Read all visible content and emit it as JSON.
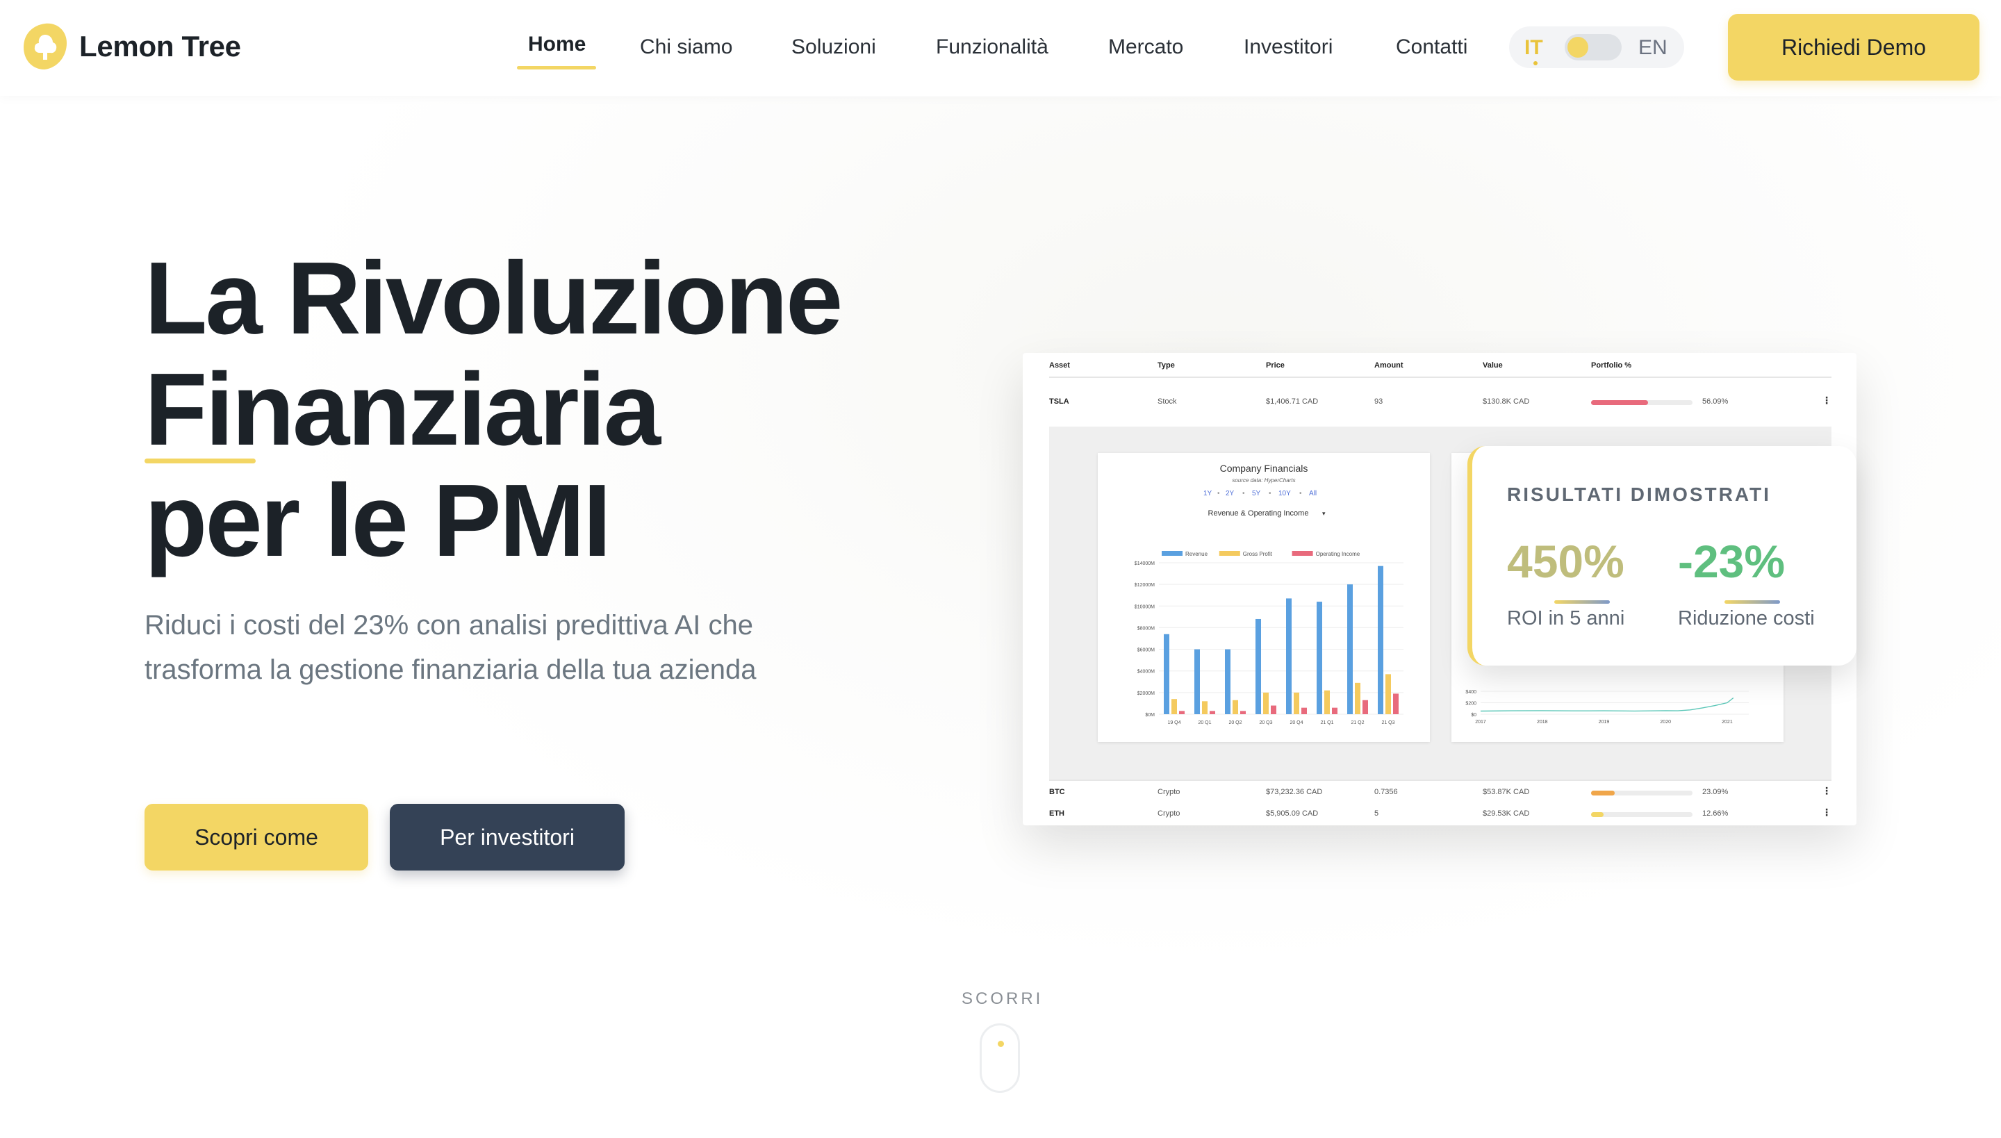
{
  "brand": {
    "name": "Lemon Tree",
    "color": "#f3d664",
    "icon": "lemon-tree-logo-icon"
  },
  "nav": {
    "items": [
      "Home",
      "Chi siamo",
      "Soluzioni",
      "Funzionalità",
      "Mercato",
      "Investitori",
      "Contatti"
    ],
    "active": "Home"
  },
  "lang": {
    "it": "IT",
    "en": "EN",
    "selected": "IT"
  },
  "header": {
    "demo_label": "Richiedi Demo"
  },
  "hero": {
    "title_line1": "La Rivoluzione",
    "title_line2": "Finanziaria",
    "title_line3": "per le PMI",
    "subtitle": "Riduci i costi del 23% con analisi predittiva AI che trasforma la gestione finanziaria della tua azienda",
    "cta_primary": "Scopri come",
    "cta_secondary": "Per investitori"
  },
  "dashboard": {
    "columns": [
      "Asset",
      "Type",
      "Price",
      "Amount",
      "Value",
      "Portfolio %"
    ],
    "rows": [
      {
        "asset": "TSLA",
        "type": "Stock",
        "price": "$1,406.71 CAD",
        "amount": "93",
        "value": "$130.8K CAD",
        "portfolio": "56.09%",
        "fill": 0.5609,
        "color": "#e86a7c"
      },
      {
        "asset": "BTC",
        "type": "Crypto",
        "price": "$73,232.36 CAD",
        "amount": "0.7356",
        "value": "$53.87K CAD",
        "portfolio": "23.09%",
        "fill": 0.2309,
        "color": "#f0a64a"
      },
      {
        "asset": "ETH",
        "type": "Crypto",
        "price": "$5,905.09 CAD",
        "amount": "5",
        "value": "$29.53K CAD",
        "portfolio": "12.66%",
        "fill": 0.1266,
        "color": "#f3d664"
      }
    ],
    "company_chart": {
      "title": "Company Financials",
      "source": "source data: HyperCharts",
      "ranges": [
        "1Y",
        "2Y",
        "5Y",
        "10Y",
        "All"
      ],
      "dropdown": "Revenue & Operating Income"
    },
    "price_chart": {
      "y_ticks": [
        "$400",
        "$200",
        "$0"
      ],
      "x_ticks": [
        "2017",
        "2018",
        "2019",
        "2020",
        "2021"
      ]
    }
  },
  "chart_data": [
    {
      "type": "bar",
      "title": "Company Financials",
      "categories": [
        "19 Q4",
        "20 Q1",
        "20 Q2",
        "20 Q3",
        "20 Q4",
        "21 Q1",
        "21 Q2",
        "21 Q3"
      ],
      "series": [
        {
          "name": "Revenue",
          "color": "#5aa0e0",
          "values": [
            7400,
            6000,
            6000,
            8800,
            10700,
            10400,
            12000,
            13700
          ]
        },
        {
          "name": "Gross Profit",
          "color": "#f4ca5e",
          "values": [
            1400,
            1200,
            1300,
            2000,
            2000,
            2200,
            2900,
            3700
          ]
        },
        {
          "name": "Operating Income",
          "color": "#e86a7c",
          "values": [
            300,
            300,
            300,
            800,
            600,
            600,
            1300,
            1900
          ]
        }
      ],
      "y_ticks": [
        "$14000M",
        "$12000M",
        "$10000M",
        "$8000M",
        "$6000M",
        "$4000M",
        "$2000M",
        "$0M"
      ],
      "ylim": [
        0,
        14000
      ]
    },
    {
      "type": "line",
      "x": [
        2017,
        2017.5,
        2018,
        2018.5,
        2019,
        2019.5,
        2020,
        2020.2,
        2020.4,
        2020.6,
        2020.8,
        2021,
        2021.1
      ],
      "values": [
        55,
        60,
        62,
        58,
        60,
        56,
        62,
        60,
        75,
        110,
        150,
        200,
        285
      ],
      "ylim": [
        0,
        450
      ],
      "color": "#5cc7b8"
    }
  ],
  "stats": {
    "title": "RISULTATI DIMOSTRATI",
    "roi_value": "450%",
    "roi_label": "ROI in 5 anni",
    "cost_value": "-23%",
    "cost_label": "Riduzione costi"
  },
  "scroll": {
    "label": "SCORRI"
  }
}
